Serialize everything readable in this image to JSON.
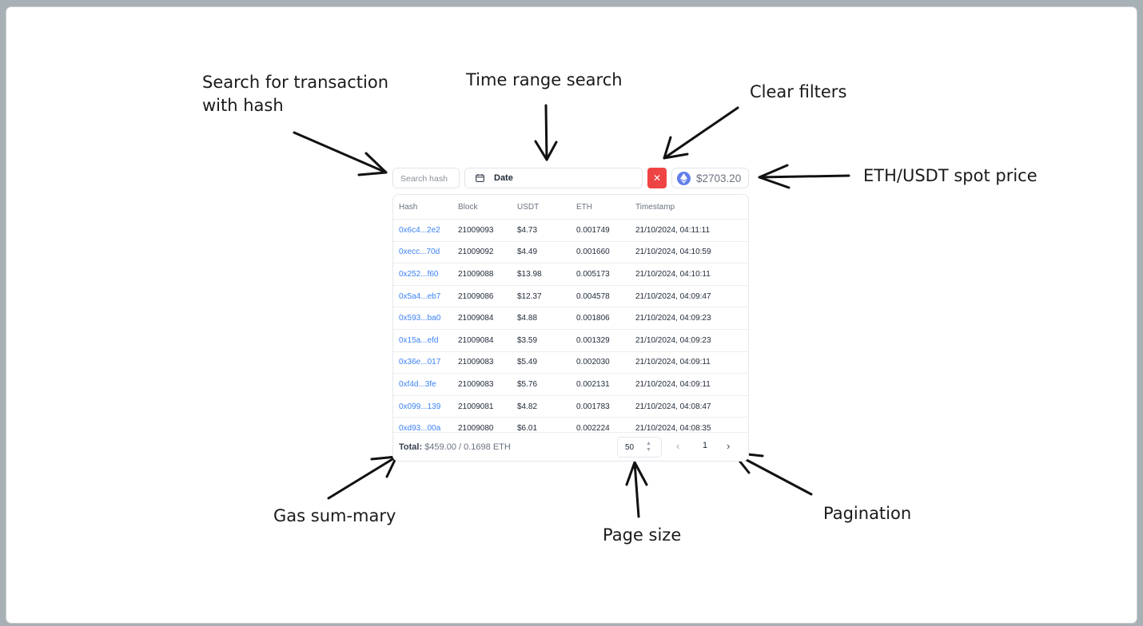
{
  "annotations": {
    "search_line1": "Search for transaction",
    "search_line2": "with hash",
    "time_range": "Time range search",
    "clear_filters": "Clear filters",
    "spot_price": "ETH/USDT spot price",
    "gas_summary": "Gas sum-mary",
    "page_size": "Page size",
    "pagination": "Pagination"
  },
  "toolbar": {
    "search_placeholder": "Search hash",
    "date_label": "Date",
    "clear_icon": "x-icon",
    "clear_glyph": "✕",
    "price": "$2703.20",
    "price_icon": "ethereum-icon"
  },
  "table": {
    "headers": [
      "Hash",
      "Block",
      "USDT",
      "ETH",
      "Timestamp"
    ],
    "rows": [
      [
        "0x6c4...2e2",
        "21009093",
        "$4.73",
        "0.001749",
        "21/10/2024, 04:11:11"
      ],
      [
        "0xecc...70d",
        "21009092",
        "$4.49",
        "0.001660",
        "21/10/2024, 04:10:59"
      ],
      [
        "0x252...f60",
        "21009088",
        "$13.98",
        "0.005173",
        "21/10/2024, 04:10:11"
      ],
      [
        "0x5a4...eb7",
        "21009086",
        "$12.37",
        "0.004578",
        "21/10/2024, 04:09:47"
      ],
      [
        "0x593...ba0",
        "21009084",
        "$4.88",
        "0.001806",
        "21/10/2024, 04:09:23"
      ],
      [
        "0x15a...efd",
        "21009084",
        "$3.59",
        "0.001329",
        "21/10/2024, 04:09:23"
      ],
      [
        "0x36e...017",
        "21009083",
        "$5.49",
        "0.002030",
        "21/10/2024, 04:09:11"
      ],
      [
        "0xf4d...3fe",
        "21009083",
        "$5.76",
        "0.002131",
        "21/10/2024, 04:09:11"
      ],
      [
        "0x099...139",
        "21009081",
        "$4.82",
        "0.001783",
        "21/10/2024, 04:08:47"
      ],
      [
        "0xd93...00a",
        "21009080",
        "$6.01",
        "0.002224",
        "21/10/2024, 04:08:35"
      ]
    ]
  },
  "footer": {
    "total_label": "Total:",
    "total_value": "$459.00 / 0.1698 ETH",
    "page_size": "50",
    "current_page": "1",
    "prev_glyph": "‹",
    "next_glyph": "›"
  },
  "colors": {
    "accent_link": "#3b82f6",
    "clear_button": "#ef4444",
    "eth_icon": "#627eea"
  }
}
